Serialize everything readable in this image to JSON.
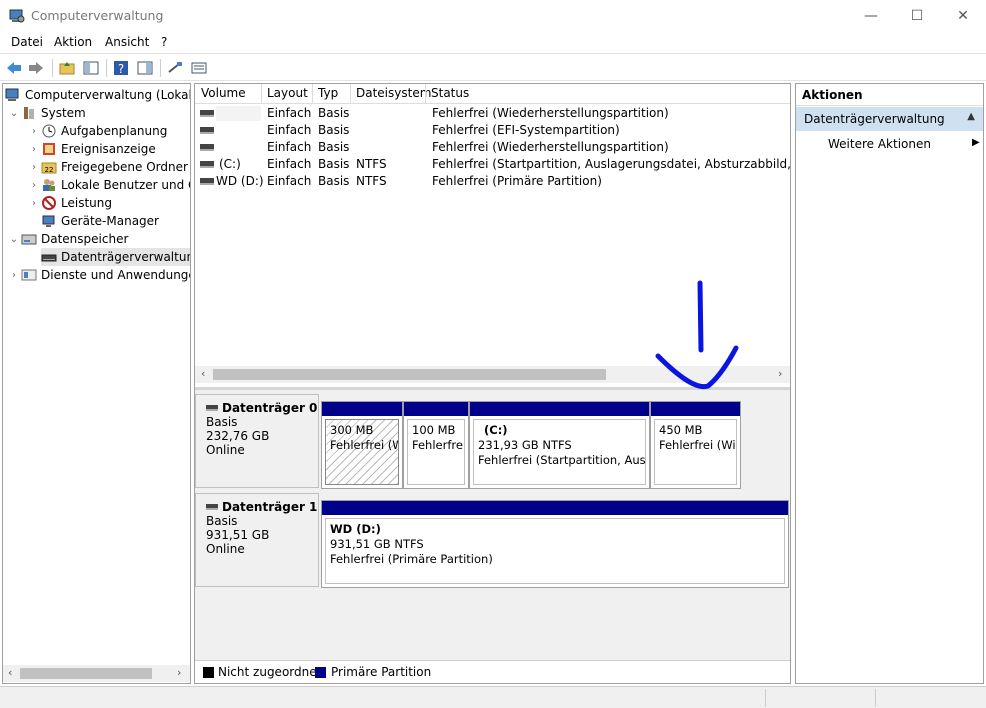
{
  "window": {
    "title": "Computerverwaltung",
    "minimize": "—",
    "maximize": "☐",
    "close": "✕"
  },
  "menu": [
    "Datei",
    "Aktion",
    "Ansicht",
    "?"
  ],
  "tree": {
    "items": [
      {
        "label": "Computerverwaltung (Lokal)",
        "icon": "computer-management-icon"
      },
      {
        "label": "System",
        "icon": "system-tools-icon"
      },
      {
        "label": "Aufgabenplanung",
        "icon": "task-scheduler-icon"
      },
      {
        "label": "Ereignisanzeige",
        "icon": "event-viewer-icon"
      },
      {
        "label": "Freigegebene Ordner",
        "icon": "shared-folders-icon"
      },
      {
        "label": "Lokale Benutzer und Gruppen",
        "icon": "users-icon"
      },
      {
        "label": "Leistung",
        "icon": "performance-icon"
      },
      {
        "label": "Geräte-Manager",
        "icon": "device-manager-icon"
      },
      {
        "label": "Datenspeicher",
        "icon": "storage-icon"
      },
      {
        "label": "Datenträgerverwaltung",
        "icon": "disk-management-icon"
      },
      {
        "label": "Dienste und Anwendungen",
        "icon": "services-icon"
      }
    ]
  },
  "volumes": {
    "headers": [
      "Volume",
      "Layout",
      "Typ",
      "Dateisystem",
      "Status"
    ],
    "rows": [
      {
        "volume": "",
        "layout": "Einfach",
        "typ": "Basis",
        "fs": "",
        "status": "Fehlerfrei (Wiederherstellungspartition)"
      },
      {
        "volume": "",
        "layout": "Einfach",
        "typ": "Basis",
        "fs": "",
        "status": "Fehlerfrei (EFI-Systempartition)"
      },
      {
        "volume": "",
        "layout": "Einfach",
        "typ": "Basis",
        "fs": "",
        "status": "Fehlerfrei (Wiederherstellungspartition)"
      },
      {
        "volume": "(C:)",
        "layout": "Einfach",
        "typ": "Basis",
        "fs": "NTFS",
        "status": "Fehlerfrei (Startpartition, Auslagerungsdatei, Absturzabbild, Primäre"
      },
      {
        "volume": "WD (D:)",
        "layout": "Einfach",
        "typ": "Basis",
        "fs": "NTFS",
        "status": "Fehlerfrei (Primäre Partition)"
      }
    ]
  },
  "disks": [
    {
      "title": "Datenträger 0",
      "type": "Basis",
      "size": "232,76 GB",
      "state": "Online",
      "partitions": [
        {
          "name": "",
          "size": "300 MB",
          "status": "Fehlerfrei (W"
        },
        {
          "name": "",
          "size": "100 MB",
          "status": "Fehlerfrei"
        },
        {
          "name": "(C:)",
          "size": "231,93 GB NTFS",
          "status": "Fehlerfrei (Startpartition, Auslag"
        },
        {
          "name": "",
          "size": "450 MB",
          "status": "Fehlerfrei (Wie"
        }
      ]
    },
    {
      "title": "Datenträger 1",
      "type": "Basis",
      "size": "931,51 GB",
      "state": "Online",
      "partitions": [
        {
          "name": "WD  (D:)",
          "size": "931,51 GB NTFS",
          "status": "Fehlerfrei (Primäre Partition)"
        }
      ]
    }
  ],
  "legend": [
    {
      "label": "Nicht zugeordnet",
      "color": "#000000"
    },
    {
      "label": "Primäre Partition",
      "color": "#00008b"
    }
  ],
  "actions": {
    "header": "Aktionen",
    "section": "Datenträgerverwaltung",
    "more": "Weitere Aktionen"
  },
  "colors": {
    "primary_partition": "#00008b",
    "annotation": "#0000ee",
    "selection": "#cfe0f0"
  }
}
